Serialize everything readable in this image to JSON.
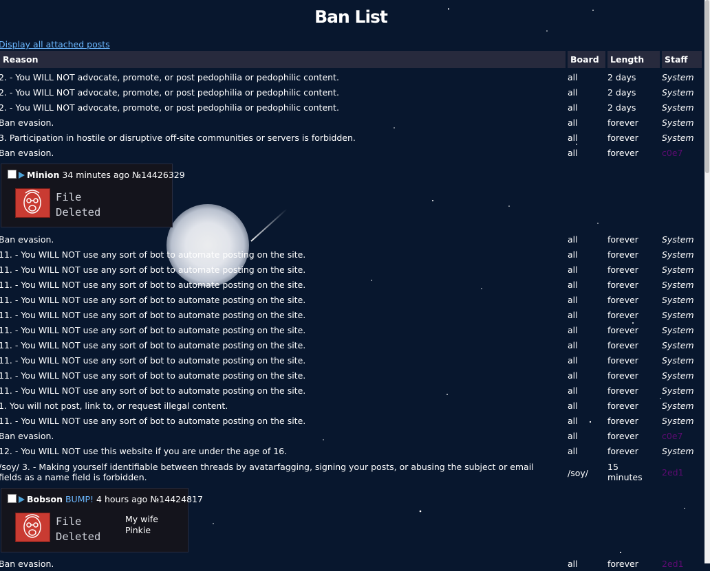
{
  "page": {
    "title": "Ban List",
    "display_all_link": "Display all attached posts"
  },
  "colors": {
    "background": "#08172e",
    "header_bg": "#272a3d",
    "link": "#6cb8ff",
    "staff_purple": "#5e0b73"
  },
  "columns": {
    "reason": "Reason",
    "board": "Board",
    "length": "Length",
    "staff": "Staff"
  },
  "bans_top": [
    {
      "reason": "2. - You WILL NOT advocate, promote, or post pedophilia or pedophilic content.",
      "board": "all",
      "length": "2 days",
      "staff": "System"
    },
    {
      "reason": "2. - You WILL NOT advocate, promote, or post pedophilia or pedophilic content.",
      "board": "all",
      "length": "2 days",
      "staff": "System"
    },
    {
      "reason": "2. - You WILL NOT advocate, promote, or post pedophilia or pedophilic content.",
      "board": "all",
      "length": "2 days",
      "staff": "System"
    },
    {
      "reason": "Ban evasion.",
      "board": "all",
      "length": "forever",
      "staff": "System"
    },
    {
      "reason": "3. Participation in hostile or disruptive off-site communities or servers is forbidden.",
      "board": "all",
      "length": "forever",
      "staff": "System"
    },
    {
      "reason": "Ban evasion.",
      "board": "all",
      "length": "forever",
      "staff": "c0e7"
    }
  ],
  "post1": {
    "name": "Minion",
    "bump": "",
    "time": "34 minutes ago",
    "number": "№14426329",
    "file_line1": "File",
    "file_line2": "Deleted",
    "text_line1": "",
    "text_line2": ""
  },
  "bans_mid": [
    {
      "reason": "Ban evasion.",
      "board": "all",
      "length": "forever",
      "staff": "System"
    },
    {
      "reason": "11. - You WILL NOT use any sort of bot to automate posting on the site.",
      "board": "all",
      "length": "forever",
      "staff": "System"
    },
    {
      "reason": "11. - You WILL NOT use any sort of bot to automate posting on the site.",
      "board": "all",
      "length": "forever",
      "staff": "System"
    },
    {
      "reason": "11. - You WILL NOT use any sort of bot to automate posting on the site.",
      "board": "all",
      "length": "forever",
      "staff": "System"
    },
    {
      "reason": "11. - You WILL NOT use any sort of bot to automate posting on the site.",
      "board": "all",
      "length": "forever",
      "staff": "System"
    },
    {
      "reason": "11. - You WILL NOT use any sort of bot to automate posting on the site.",
      "board": "all",
      "length": "forever",
      "staff": "System"
    },
    {
      "reason": "11. - You WILL NOT use any sort of bot to automate posting on the site.",
      "board": "all",
      "length": "forever",
      "staff": "System"
    },
    {
      "reason": "11. - You WILL NOT use any sort of bot to automate posting on the site.",
      "board": "all",
      "length": "forever",
      "staff": "System"
    },
    {
      "reason": "11. - You WILL NOT use any sort of bot to automate posting on the site.",
      "board": "all",
      "length": "forever",
      "staff": "System"
    },
    {
      "reason": "11. - You WILL NOT use any sort of bot to automate posting on the site.",
      "board": "all",
      "length": "forever",
      "staff": "System"
    },
    {
      "reason": "11. - You WILL NOT use any sort of bot to automate posting on the site.",
      "board": "all",
      "length": "forever",
      "staff": "System"
    },
    {
      "reason": "1. You will not post, link to, or request illegal content.",
      "board": "all",
      "length": "forever",
      "staff": "System"
    },
    {
      "reason": "11. - You WILL NOT use any sort of bot to automate posting on the site.",
      "board": "all",
      "length": "forever",
      "staff": "System"
    },
    {
      "reason": "Ban evasion.",
      "board": "all",
      "length": "forever",
      "staff": "c0e7"
    },
    {
      "reason": "12. - You WILL NOT use this website if you are under the age of 16.",
      "board": "all",
      "length": "forever",
      "staff": "System"
    }
  ],
  "ban_soy": {
    "reason": "/soy/ 3. - Making yourself identifiable between threads by avatarfagging, signing your posts, or abusing the subject or email fields as a name field is forbidden.",
    "board": "/soy/",
    "length": "15 minutes",
    "staff": "2ed1"
  },
  "post2": {
    "name": "Bobson",
    "bump": "BUMP!",
    "time": "4 hours ago",
    "number": "№14424817",
    "file_line1": "File",
    "file_line2": "Deleted",
    "text_line1": "My wife",
    "text_line2": "Pinkie"
  },
  "ban_bottom": {
    "reason": "Ban evasion.",
    "board": "all",
    "length": "forever",
    "staff": "2ed1"
  }
}
